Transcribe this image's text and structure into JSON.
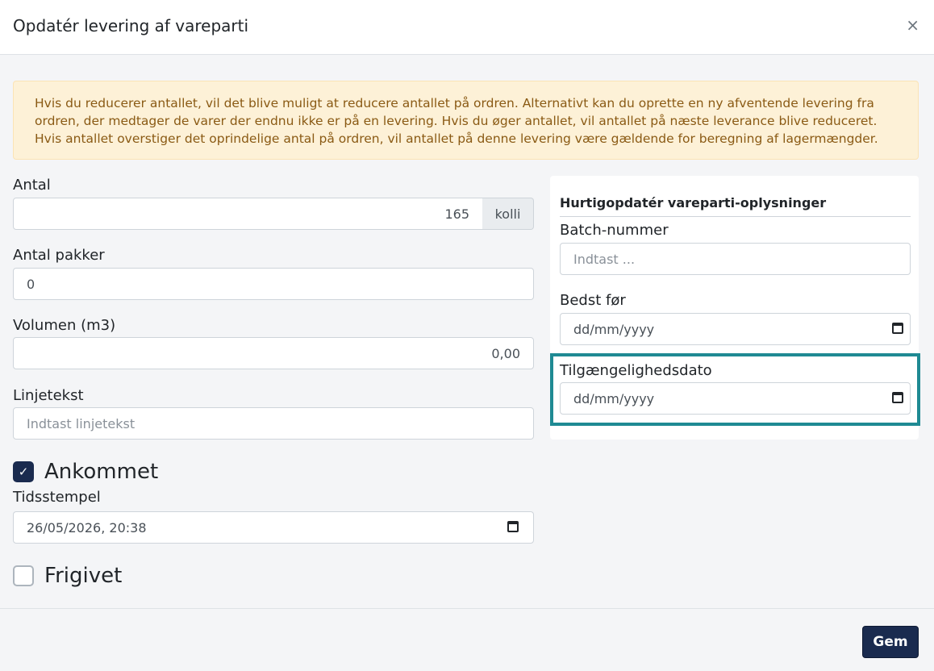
{
  "modal": {
    "title": "Opdatér levering af vareparti",
    "close_glyph": "×"
  },
  "alert": {
    "text": "Hvis du reducerer antallet, vil det blive muligt at reducere antallet på ordren. Alternativt kan du oprette en ny afventende levering fra ordren, der medtager de varer der endnu ikke er på en levering. Hvis du øger antallet, vil antallet på næste leverance blive reduceret. Hvis antallet overstiger det oprindelige antal på ordren, vil antallet på denne levering være gældende for beregning af lagermængder."
  },
  "form": {
    "antal": {
      "label": "Antal",
      "value": "165",
      "unit": "kolli"
    },
    "antal_pakker": {
      "label": "Antal pakker",
      "value": "0"
    },
    "volumen": {
      "label": "Volumen (m3)",
      "value": "0,00"
    },
    "linjetekst": {
      "label": "Linjetekst",
      "placeholder": "Indtast linjetekst"
    },
    "ankommet": {
      "label": "Ankommet",
      "checked": true
    },
    "tidsstempel": {
      "label": "Tidsstempel",
      "value": "26/05/2026, 20:38"
    },
    "frigivet": {
      "label": "Frigivet",
      "checked": false
    }
  },
  "panel": {
    "title": "Hurtigopdatér vareparti-oplysninger",
    "batch": {
      "label": "Batch-nummer",
      "placeholder": "Indtast ..."
    },
    "bedst_foer": {
      "label": "Bedst før",
      "placeholder": "dd/mm/yyyy"
    },
    "tilgaengelighedsdato": {
      "label": "Tilgængelighedsdato",
      "placeholder": "dd/mm/yyyy"
    }
  },
  "footer": {
    "save_label": "Gem"
  },
  "colors": {
    "primary": "#1a2b4f",
    "alert_bg": "#fdf1d7",
    "alert_text": "#8a5a14",
    "highlight": "#1f8a93"
  },
  "icons": {
    "close": "close-icon",
    "calendar": "calendar-icon",
    "check": "check-icon"
  }
}
